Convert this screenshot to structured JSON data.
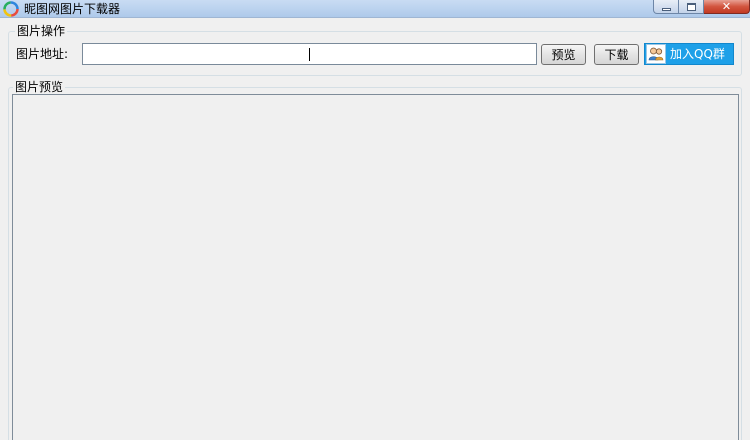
{
  "window": {
    "title": "昵图网图片下载器",
    "close_glyph": "✕"
  },
  "ops_group": {
    "legend": "图片操作",
    "address_label": "图片地址:",
    "address_value": "",
    "address_placeholder": "",
    "preview_button": "预览",
    "download_button": "下载",
    "qq_button": "加入QQ群",
    "qq_button_color": "#1ea0e8"
  },
  "preview_group": {
    "legend": "图片预览"
  }
}
